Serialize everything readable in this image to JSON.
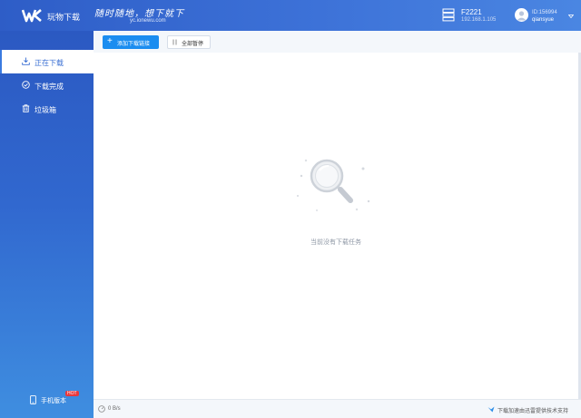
{
  "header": {
    "app_name": "玩物下载",
    "slogan": "随时随地，想下就下",
    "site": "yc.ionewu.com",
    "device": {
      "name": "F2221",
      "ip": "192.168.1.105"
    },
    "user": {
      "id": "ID:156994",
      "name": "qiansyue"
    }
  },
  "sidebar": {
    "items": [
      {
        "label": "正在下载",
        "icon": "download-icon",
        "active": true
      },
      {
        "label": "下载完成",
        "icon": "check-circle-icon",
        "active": false
      },
      {
        "label": "垃圾箱",
        "icon": "trash-icon",
        "active": false
      }
    ],
    "mobile": {
      "label": "手机版本",
      "badge": "HOT"
    }
  },
  "toolbar": {
    "add_label": "添加下载链接",
    "pause_label": "全部暂停"
  },
  "main": {
    "empty_text": "当前没有下载任务"
  },
  "status": {
    "speed": "0 B/s",
    "credit": "下载加速由迅雷提供技术支持"
  },
  "colors": {
    "accent": "#1b8df0",
    "header": "#3d72d8",
    "sidebar_bottom": "#3f8ee0"
  }
}
